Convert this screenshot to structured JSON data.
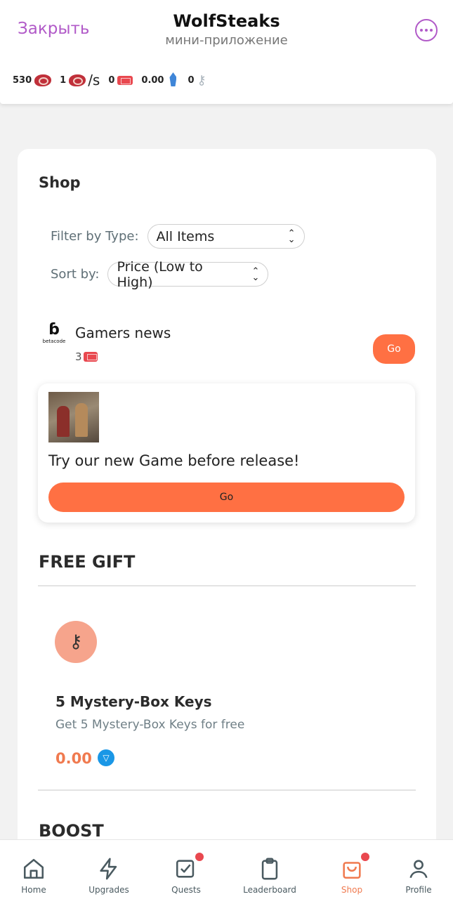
{
  "header": {
    "close_label": "Закрыть",
    "title": "WolfSteaks",
    "subtitle": "мини-приложение"
  },
  "stats": {
    "steaks": "530",
    "rate": "1",
    "rate_unit": "/s",
    "tickets": "0",
    "crystals": "0.00",
    "keys": "0"
  },
  "shop": {
    "title": "Shop",
    "filter_label": "Filter by Type:",
    "filter_value": "All Items",
    "sort_label": "Sort by:",
    "sort_value": "Price (Low to High)"
  },
  "news_ad": {
    "logo_text": "betacode",
    "title": "Gamers news",
    "count": "3",
    "go_label": "Go"
  },
  "promo": {
    "text": "Try our new Game before release!",
    "go_label": "Go"
  },
  "free_gift": {
    "section_title": "FREE GIFT",
    "name": "5 Mystery-Box Keys",
    "description": "Get 5 Mystery-Box Keys for free",
    "price": "0.00"
  },
  "boost": {
    "section_title": "BOOST"
  },
  "nav": {
    "items": [
      {
        "label": "Home",
        "icon": "home-icon"
      },
      {
        "label": "Upgrades",
        "icon": "bolt-icon"
      },
      {
        "label": "Quests",
        "icon": "checkbox-icon"
      },
      {
        "label": "Leaderboard",
        "icon": "clipboard-icon"
      },
      {
        "label": "Shop",
        "icon": "shopping-bag-icon"
      },
      {
        "label": "Profile",
        "icon": "user-icon"
      }
    ],
    "active": "Shop"
  },
  "colors": {
    "accent": "#ff7043",
    "brand_purple": "#b15ac8",
    "badge_red": "#e9484f",
    "ton_blue": "#1a97e6"
  }
}
